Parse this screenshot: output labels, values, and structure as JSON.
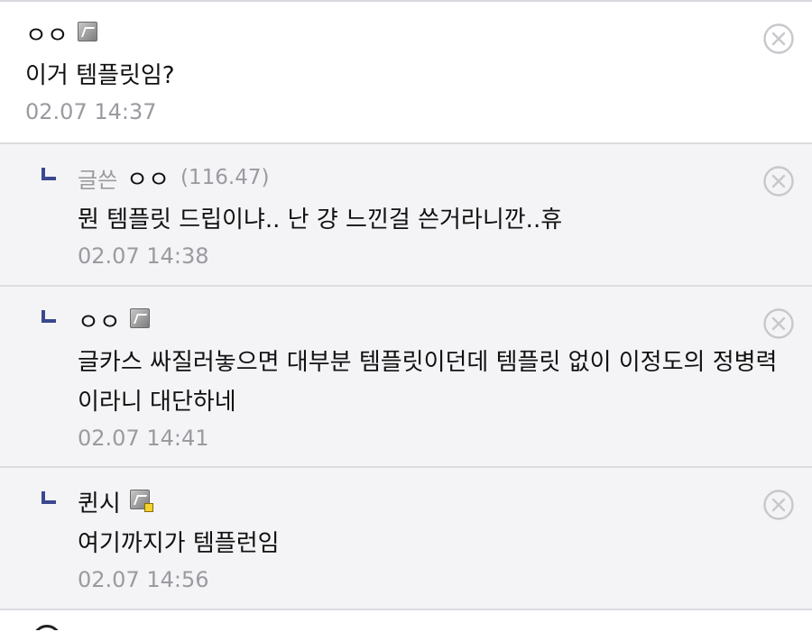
{
  "comments": [
    {
      "type": "main",
      "nick": "ㅇㅇ",
      "badge": "fixed-nick-badge",
      "content": "이거 템플릿임?",
      "date": "02.07 14:37"
    },
    {
      "type": "reply",
      "writer_tag": "글쓴",
      "nick": "ㅇㅇ",
      "ip": "(116.47)",
      "content": "뭔 템플릿 드립이냐.. 난 걍 느낀걸 쓴거라니깐..휴",
      "date": "02.07 14:38"
    },
    {
      "type": "reply",
      "nick": "ㅇㅇ",
      "badge": "fixed-nick-badge",
      "content": "글카스 싸질러놓으면 대부분 템플릿이던데 템플릿 없이 이정도의 정병력이라니 대단하네",
      "date": "02.07 14:41"
    },
    {
      "type": "reply",
      "nick": "퀸시",
      "badge": "manager-badge",
      "content": "여기까지가 템플런임",
      "date": "02.07 14:56"
    }
  ],
  "colors": {
    "reply_bg": "#f4f4f6",
    "reply_arrow": "#3b4890",
    "muted_text": "#9a9aa0",
    "divider": "#dcdce0"
  }
}
